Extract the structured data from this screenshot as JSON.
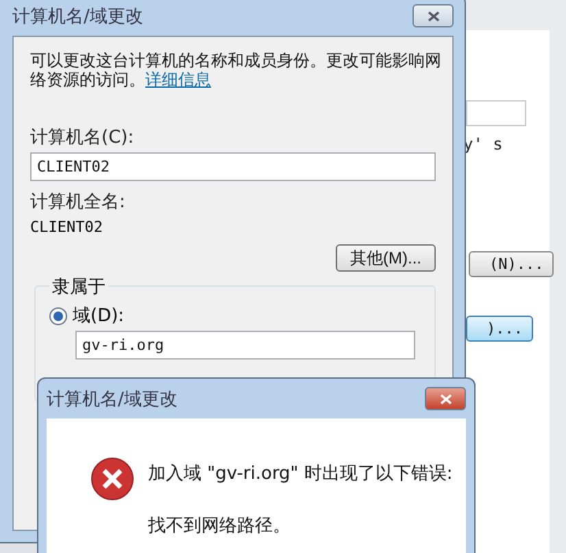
{
  "background_window": {
    "partial_text": "y' s",
    "buttons": [
      {
        "label": "(N)...",
        "default": false
      },
      {
        "label": ")...",
        "default": true
      }
    ]
  },
  "dialog": {
    "title": "计算机名/域更改",
    "description": "可以更改这台计算机的名称和成员身份。更改可能影响网络资源的访问。",
    "link": "详细信息",
    "computer_name_label": "计算机名(C):",
    "computer_name": "CLIENT02",
    "full_name_label": "计算机全名:",
    "full_name": "CLIENT02",
    "more_button": "其他(M)...",
    "member_of": {
      "label": "隶属于",
      "options": [
        {
          "label": "域(D):",
          "selected": true,
          "value": "gv-ri.org"
        }
      ]
    }
  },
  "error_dialog": {
    "title": "计算机名/域更改",
    "message": "加入域 \"gv-ri.org\" 时出现了以下错误:",
    "detail": "找不到网络路径。"
  }
}
